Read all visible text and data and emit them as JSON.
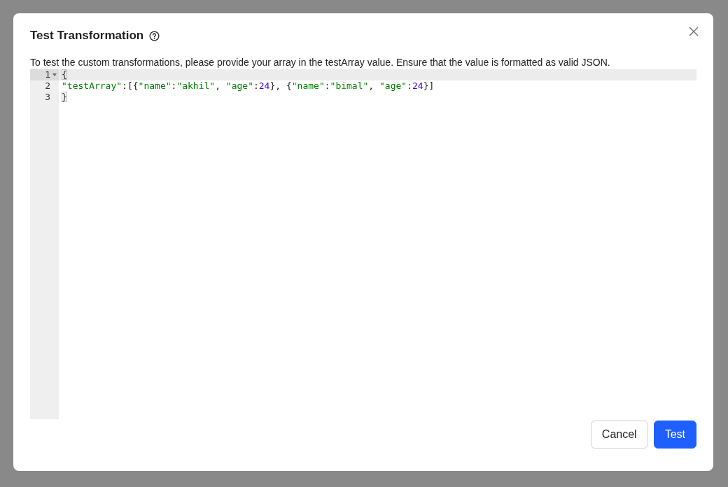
{
  "dialog": {
    "title": "Test Transformation",
    "description": "To test the custom transformations, please provide your array in the testArray value. Ensure that the value is formatted as valid JSON.",
    "editor": {
      "lines": [
        {
          "number": "1",
          "selected": true,
          "foldable": true,
          "tokens": [
            {
              "kind": "punct",
              "text": "{",
              "matched": true
            }
          ]
        },
        {
          "number": "2",
          "selected": false,
          "foldable": false,
          "tokens": [
            {
              "kind": "string",
              "text": "\"testArray\""
            },
            {
              "kind": "punct",
              "text": ":[{"
            },
            {
              "kind": "string",
              "text": "\"name\""
            },
            {
              "kind": "punct",
              "text": ":"
            },
            {
              "kind": "string",
              "text": "\"akhil\""
            },
            {
              "kind": "punct",
              "text": ", "
            },
            {
              "kind": "string",
              "text": "\"age\""
            },
            {
              "kind": "punct",
              "text": ":"
            },
            {
              "kind": "number",
              "text": "24"
            },
            {
              "kind": "punct",
              "text": "}, {"
            },
            {
              "kind": "string",
              "text": "\"name\""
            },
            {
              "kind": "punct",
              "text": ":"
            },
            {
              "kind": "string",
              "text": "\"bimal\""
            },
            {
              "kind": "punct",
              "text": ", "
            },
            {
              "kind": "string",
              "text": "\"age\""
            },
            {
              "kind": "punct",
              "text": ":"
            },
            {
              "kind": "number",
              "text": "24"
            },
            {
              "kind": "punct",
              "text": "}]"
            }
          ]
        },
        {
          "number": "3",
          "selected": false,
          "foldable": false,
          "tokens": [
            {
              "kind": "punct",
              "text": "}",
              "matched": true
            }
          ]
        }
      ]
    },
    "buttons": [
      {
        "label": "Cancel",
        "kind": "secondary"
      },
      {
        "label": "Test",
        "kind": "primary"
      }
    ]
  }
}
